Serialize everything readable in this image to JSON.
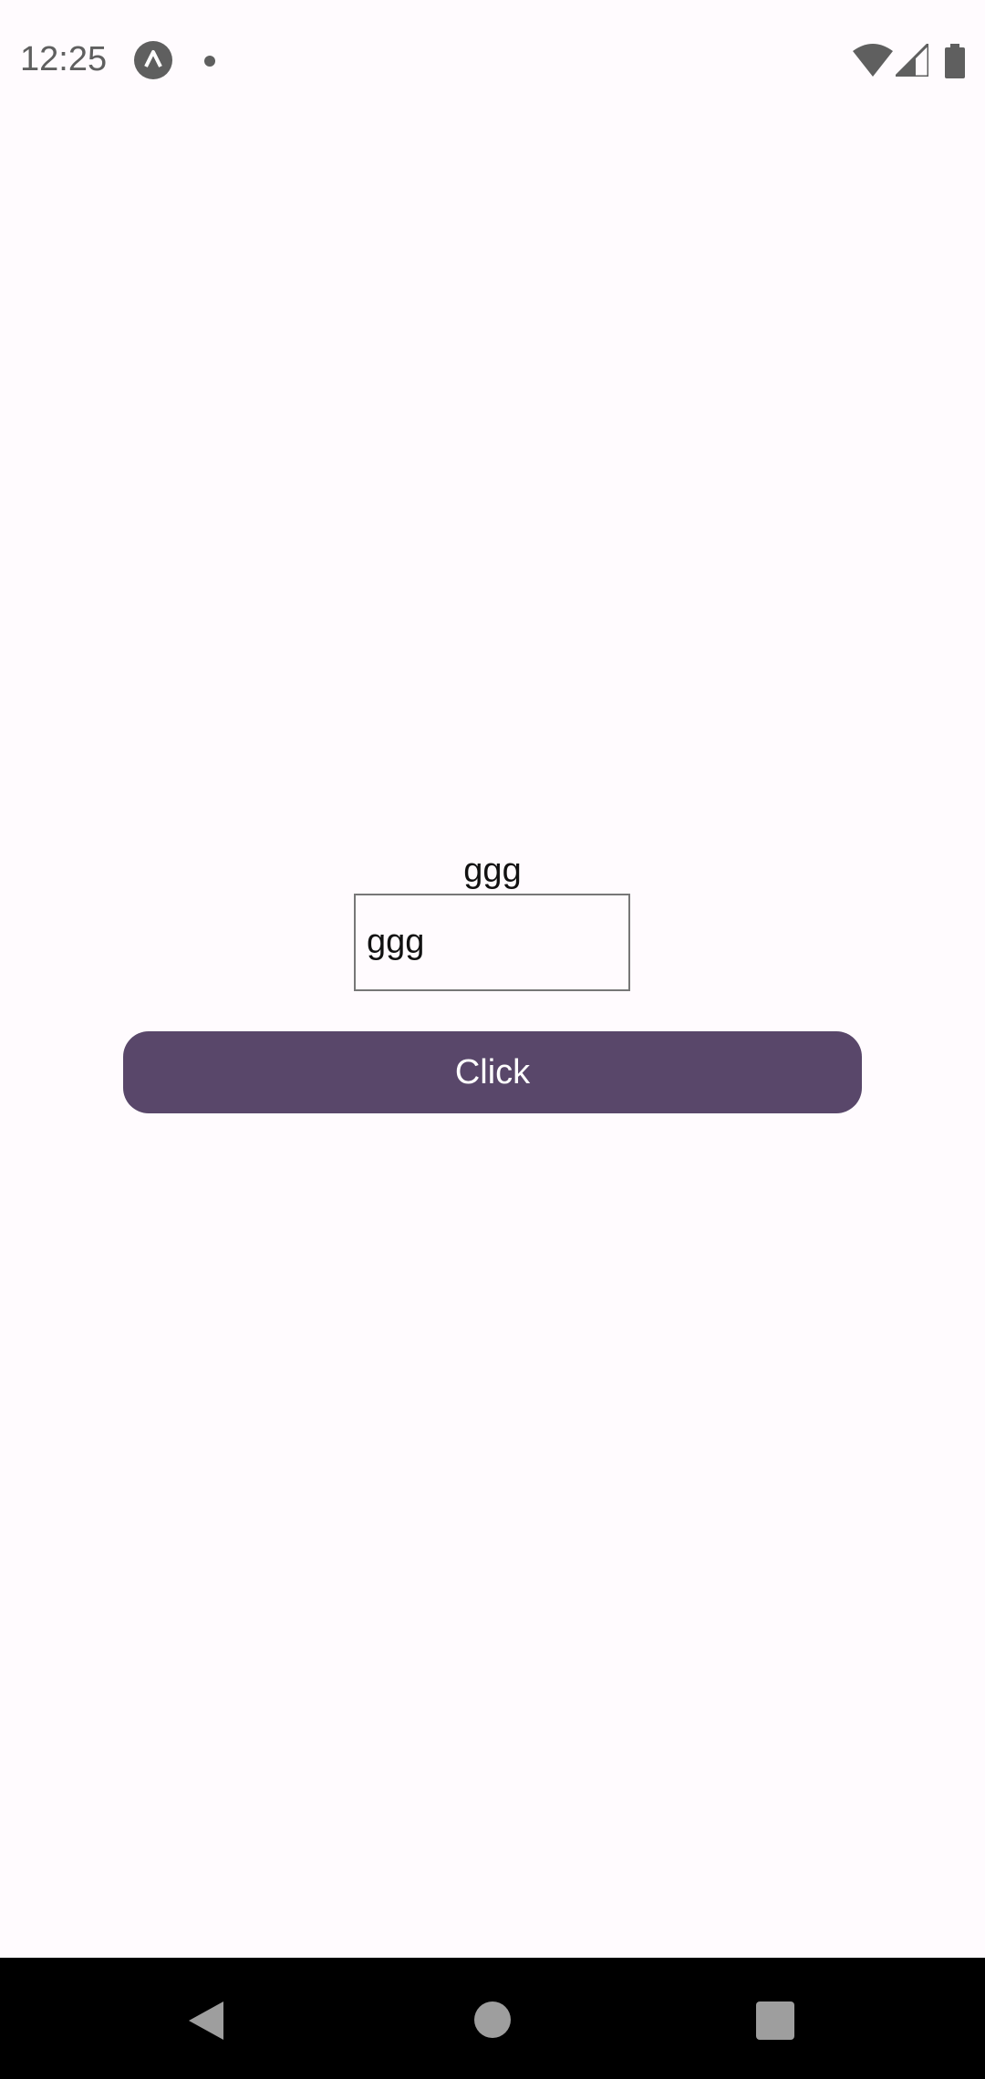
{
  "status_bar": {
    "time": "12:25",
    "icons": [
      "app-notification-icon",
      "dot-icon",
      "wifi-icon",
      "cell-signal-icon",
      "battery-icon"
    ]
  },
  "main": {
    "label": "ggg",
    "input_value": "ggg",
    "button_label": "Click"
  },
  "colors": {
    "button_background": "#59476a",
    "button_text": "#ffffff",
    "background": "#fffbfe",
    "nav_bar": "#000000"
  },
  "nav_bar": {
    "icons": [
      "back-icon",
      "home-icon",
      "recents-icon"
    ]
  }
}
